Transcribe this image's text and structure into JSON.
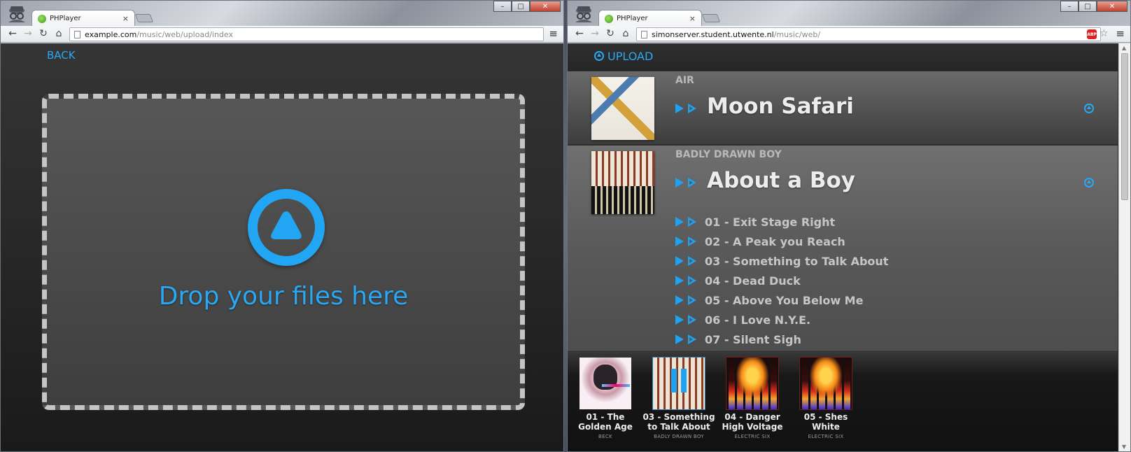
{
  "left": {
    "tab": {
      "title": "PHPlayer",
      "close": "×"
    },
    "url": {
      "domain": "example.com",
      "path": "/music/web/upload/index"
    },
    "back_label": "BACK",
    "drop_text": "Drop your files here"
  },
  "right": {
    "tab": {
      "title": "PHPlayer",
      "close": "×"
    },
    "url": {
      "domain": "simonserver.student.utwente.nl",
      "path": "/music/web/"
    },
    "abp_label": "ABP",
    "upload_label": "UPLOAD",
    "albums": [
      {
        "artist": "AIR",
        "title": "Moon Safari"
      },
      {
        "artist": "BADLY DRAWN BOY",
        "title": "About a Boy"
      }
    ],
    "tracks": [
      "01 - Exit Stage Right",
      "02 - A Peak you Reach",
      "03 - Something to Talk About",
      "04 - Dead Duck",
      "05 - Above You Below Me",
      "06 - I Love N.Y.E.",
      "07 - Silent Sigh"
    ],
    "queue": [
      {
        "title": "01 - The Golden Age",
        "artist": "BECK"
      },
      {
        "title": "03 - Something to Talk About",
        "artist": "BADLY DRAWN BOY"
      },
      {
        "title": "04 - Danger High Voltage",
        "artist": "ELECTRIC SIX"
      },
      {
        "title": "05 - Shes White",
        "artist": "ELECTRIC SIX"
      }
    ]
  },
  "icons": {
    "back": "←",
    "forward": "→",
    "reload": "↻",
    "home": "⌂",
    "menu": "≡",
    "star": "☆",
    "minimize": "–",
    "maximize": "□",
    "close": "✕",
    "scroll_up": "▲",
    "scroll_down": "▼"
  },
  "colors": {
    "accent": "#29a9f5",
    "background": "#2d2d2d"
  }
}
